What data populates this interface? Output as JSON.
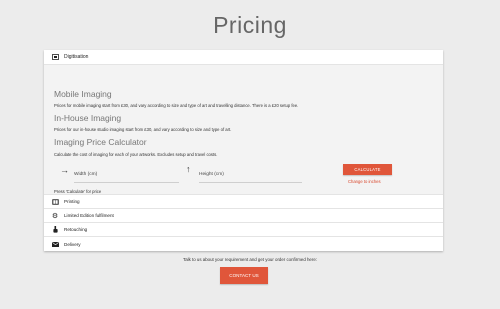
{
  "page": {
    "title": "Pricing"
  },
  "accordion": {
    "open_item": {
      "icon": "image-frame-icon",
      "label": "Digitisation"
    },
    "mobile": {
      "heading": "Mobile Imaging",
      "text": "Prices for mobile imaging start from £30, and vary according to size and type of art and travelling distance. There is a £20 setup fee."
    },
    "inhouse": {
      "heading": "In-House Imaging",
      "text": "Prices for our in-house studio imaging start from £30, and vary according to size and type of art."
    },
    "calculator": {
      "heading": "Imaging Price Calculator",
      "text": "Calculate the cost of imaging for each of your artworks. Excludes setup and travel costs.",
      "width_label": "Width (cm)",
      "height_label": "Height (cm)",
      "calculate_label": "CALCULATE",
      "inches_link": "Change to inches",
      "note": "Press 'Calculate' for price"
    },
    "items": [
      {
        "icon": "book-icon",
        "label": "Printing"
      },
      {
        "icon": "gear-icon",
        "label": "Limited Edition fulfilment"
      },
      {
        "icon": "hand-icon",
        "label": "Retouching"
      },
      {
        "icon": "envelope-icon",
        "label": "Delivery"
      }
    ]
  },
  "footer": {
    "talk_text": "Talk to us about your requirement and get your order confirmed here:",
    "contact_label": "CONTACT US"
  },
  "colors": {
    "accent": "#e0563a",
    "background": "#ececec"
  }
}
